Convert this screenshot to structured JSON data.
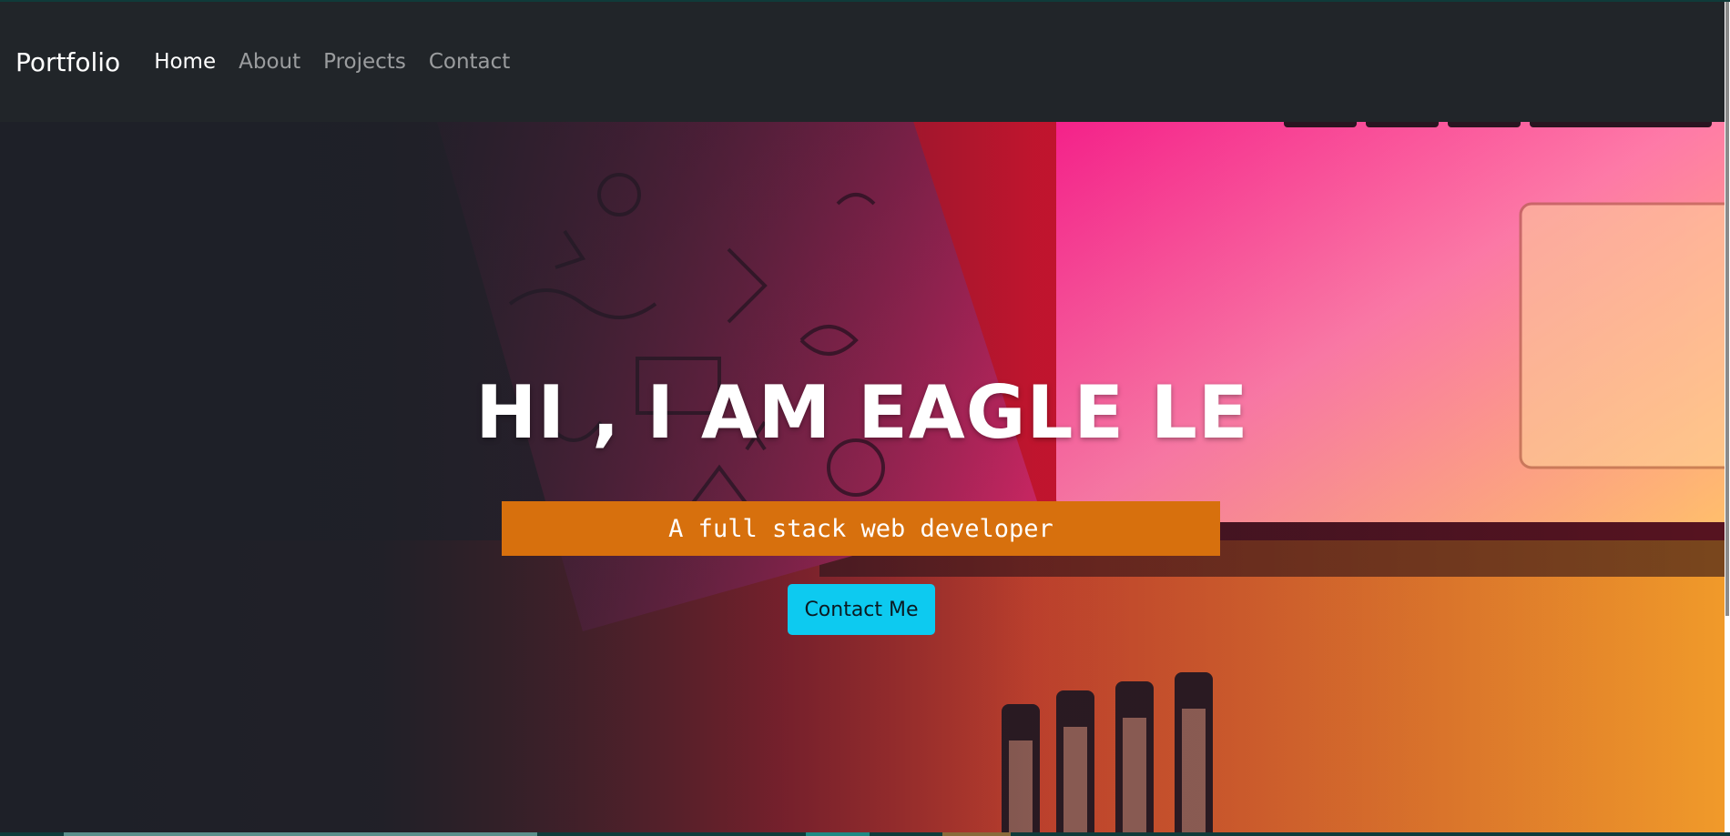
{
  "navbar": {
    "brand": "Portfolio",
    "links": [
      {
        "label": "Home",
        "active": true
      },
      {
        "label": "About",
        "active": false
      },
      {
        "label": "Projects",
        "active": false
      },
      {
        "label": "Contact",
        "active": false
      }
    ]
  },
  "hero": {
    "title": "HI , I AM EAGLE LE",
    "subtitle": "A full stack web developer",
    "cta_label": "Contact Me"
  },
  "colors": {
    "navbar_bg": "#212529",
    "subtitle_bg": "#d7700d",
    "cta_bg": "#0dcaf0",
    "accent_pink": "#ff2d8a",
    "accent_orange": "#f08a2a"
  }
}
